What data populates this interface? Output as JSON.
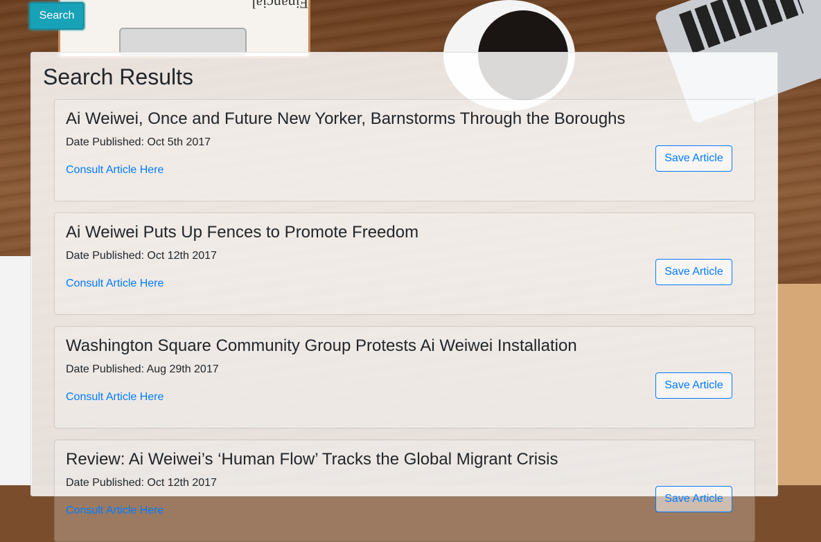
{
  "header": {
    "search_label": "Search"
  },
  "background": {
    "clipboard_text": "Financial plan"
  },
  "results": {
    "title": "Search Results",
    "date_prefix": "Date Published:",
    "articles": [
      {
        "title": "Ai Weiwei, Once and Future New Yorker, Barnstorms Through the Boroughs",
        "date": "Oct 5th 2017",
        "link_label": "Consult Article Here",
        "save_label": "Save Article"
      },
      {
        "title": "Ai Weiwei Puts Up Fences to Promote Freedom",
        "date": "Oct 12th 2017",
        "link_label": "Consult Article Here",
        "save_label": "Save Article"
      },
      {
        "title": "Washington Square Community Group Protests Ai Weiwei Installation",
        "date": "Aug 29th 2017",
        "link_label": "Consult Article Here",
        "save_label": "Save Article"
      },
      {
        "title": "Review: Ai Weiwei’s ‘Human Flow’ Tracks the Global Migrant Crisis",
        "date": "Oct 12th 2017",
        "link_label": "Consult Article Here",
        "save_label": "Save Article"
      }
    ]
  },
  "colors": {
    "search_button": "#17a2b8",
    "link": "#007bff",
    "text": "#212529"
  }
}
